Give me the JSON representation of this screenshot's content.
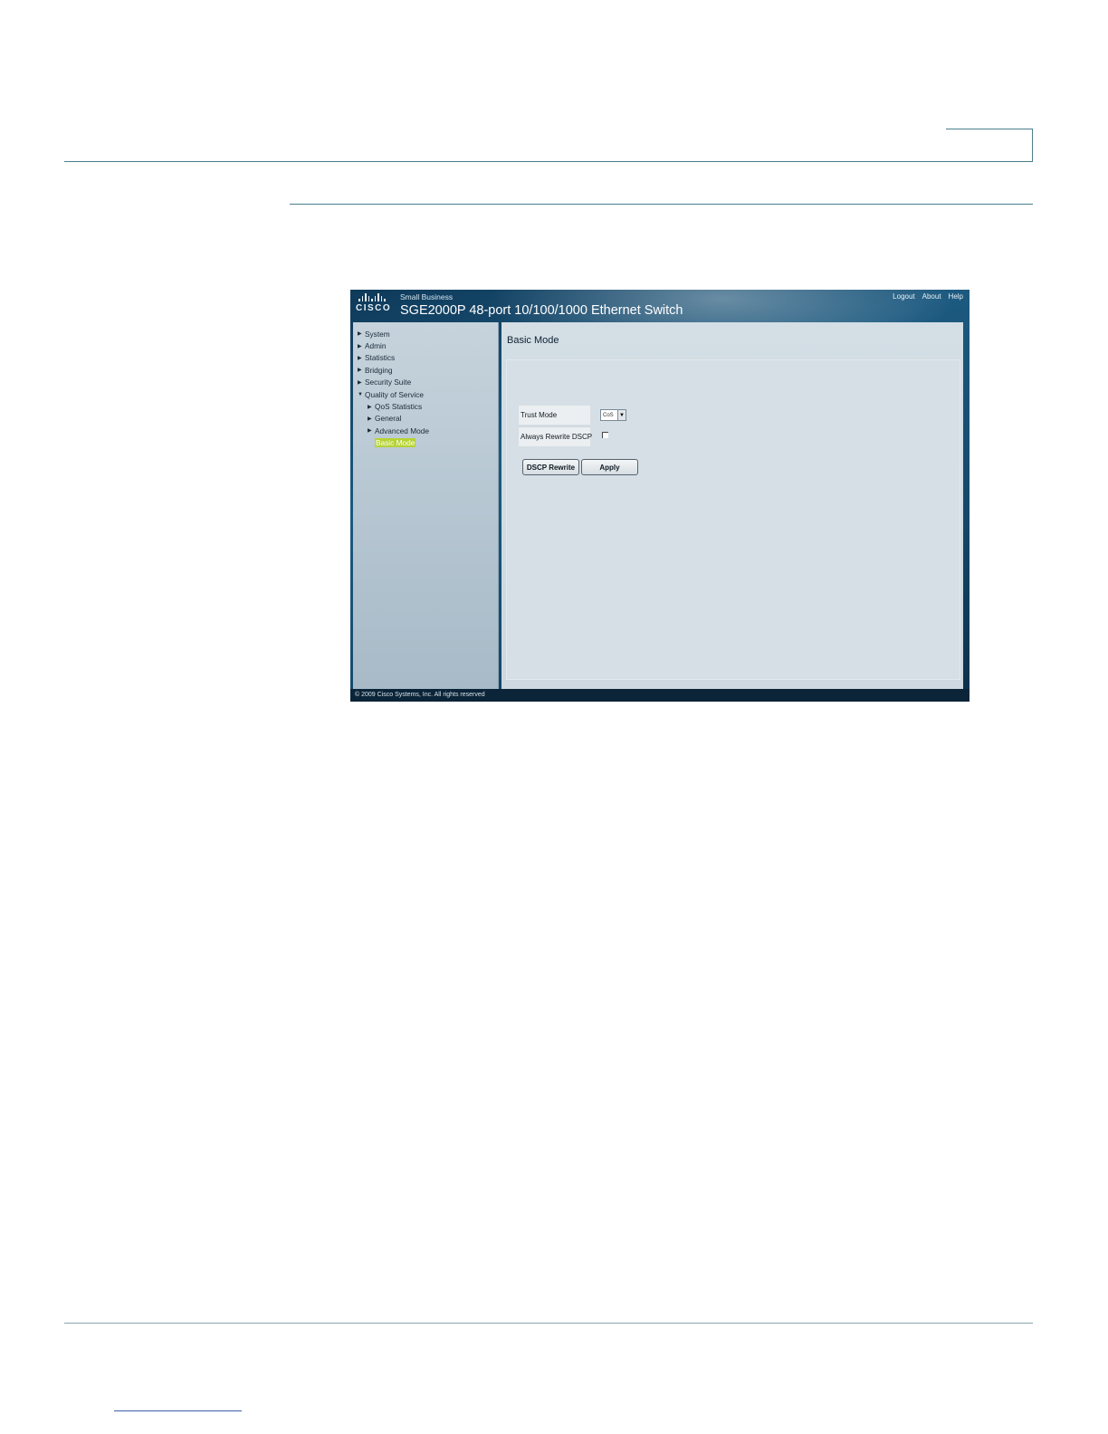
{
  "app": {
    "brand_logo_text": "CISCO",
    "brand_small": "Small Business",
    "product_title": "SGE2000P 48-port 10/100/1000 Ethernet Switch",
    "top_links": [
      "Logout",
      "About",
      "Help"
    ]
  },
  "sidebar": {
    "items": [
      {
        "label": "System",
        "level": 0,
        "expanded": false
      },
      {
        "label": "Admin",
        "level": 0,
        "expanded": false
      },
      {
        "label": "Statistics",
        "level": 0,
        "expanded": false
      },
      {
        "label": "Bridging",
        "level": 0,
        "expanded": false
      },
      {
        "label": "Security Suite",
        "level": 0,
        "expanded": false
      },
      {
        "label": "Quality of Service",
        "level": 0,
        "expanded": true
      },
      {
        "label": "QoS Statistics",
        "level": 1,
        "expanded": false
      },
      {
        "label": "General",
        "level": 1,
        "expanded": false
      },
      {
        "label": "Advanced Mode",
        "level": 1,
        "expanded": false
      },
      {
        "label": "Basic Mode",
        "level": 1,
        "active": true
      }
    ]
  },
  "main": {
    "page_title": "Basic Mode",
    "trust_mode_label": "Trust Mode",
    "trust_mode_value": "CoS",
    "always_rewrite_label": "Always Rewrite DSCP",
    "always_rewrite_checked": false,
    "dscp_rewrite_button": "DSCP Rewrite",
    "apply_button": "Apply"
  },
  "footer": {
    "copyright": "© 2009 Cisco Systems, Inc. All rights reserved"
  },
  "colors": {
    "header_bg": "#1d5a80",
    "active_nav": "#b6d335",
    "doc_rule": "#4a7f8c"
  }
}
